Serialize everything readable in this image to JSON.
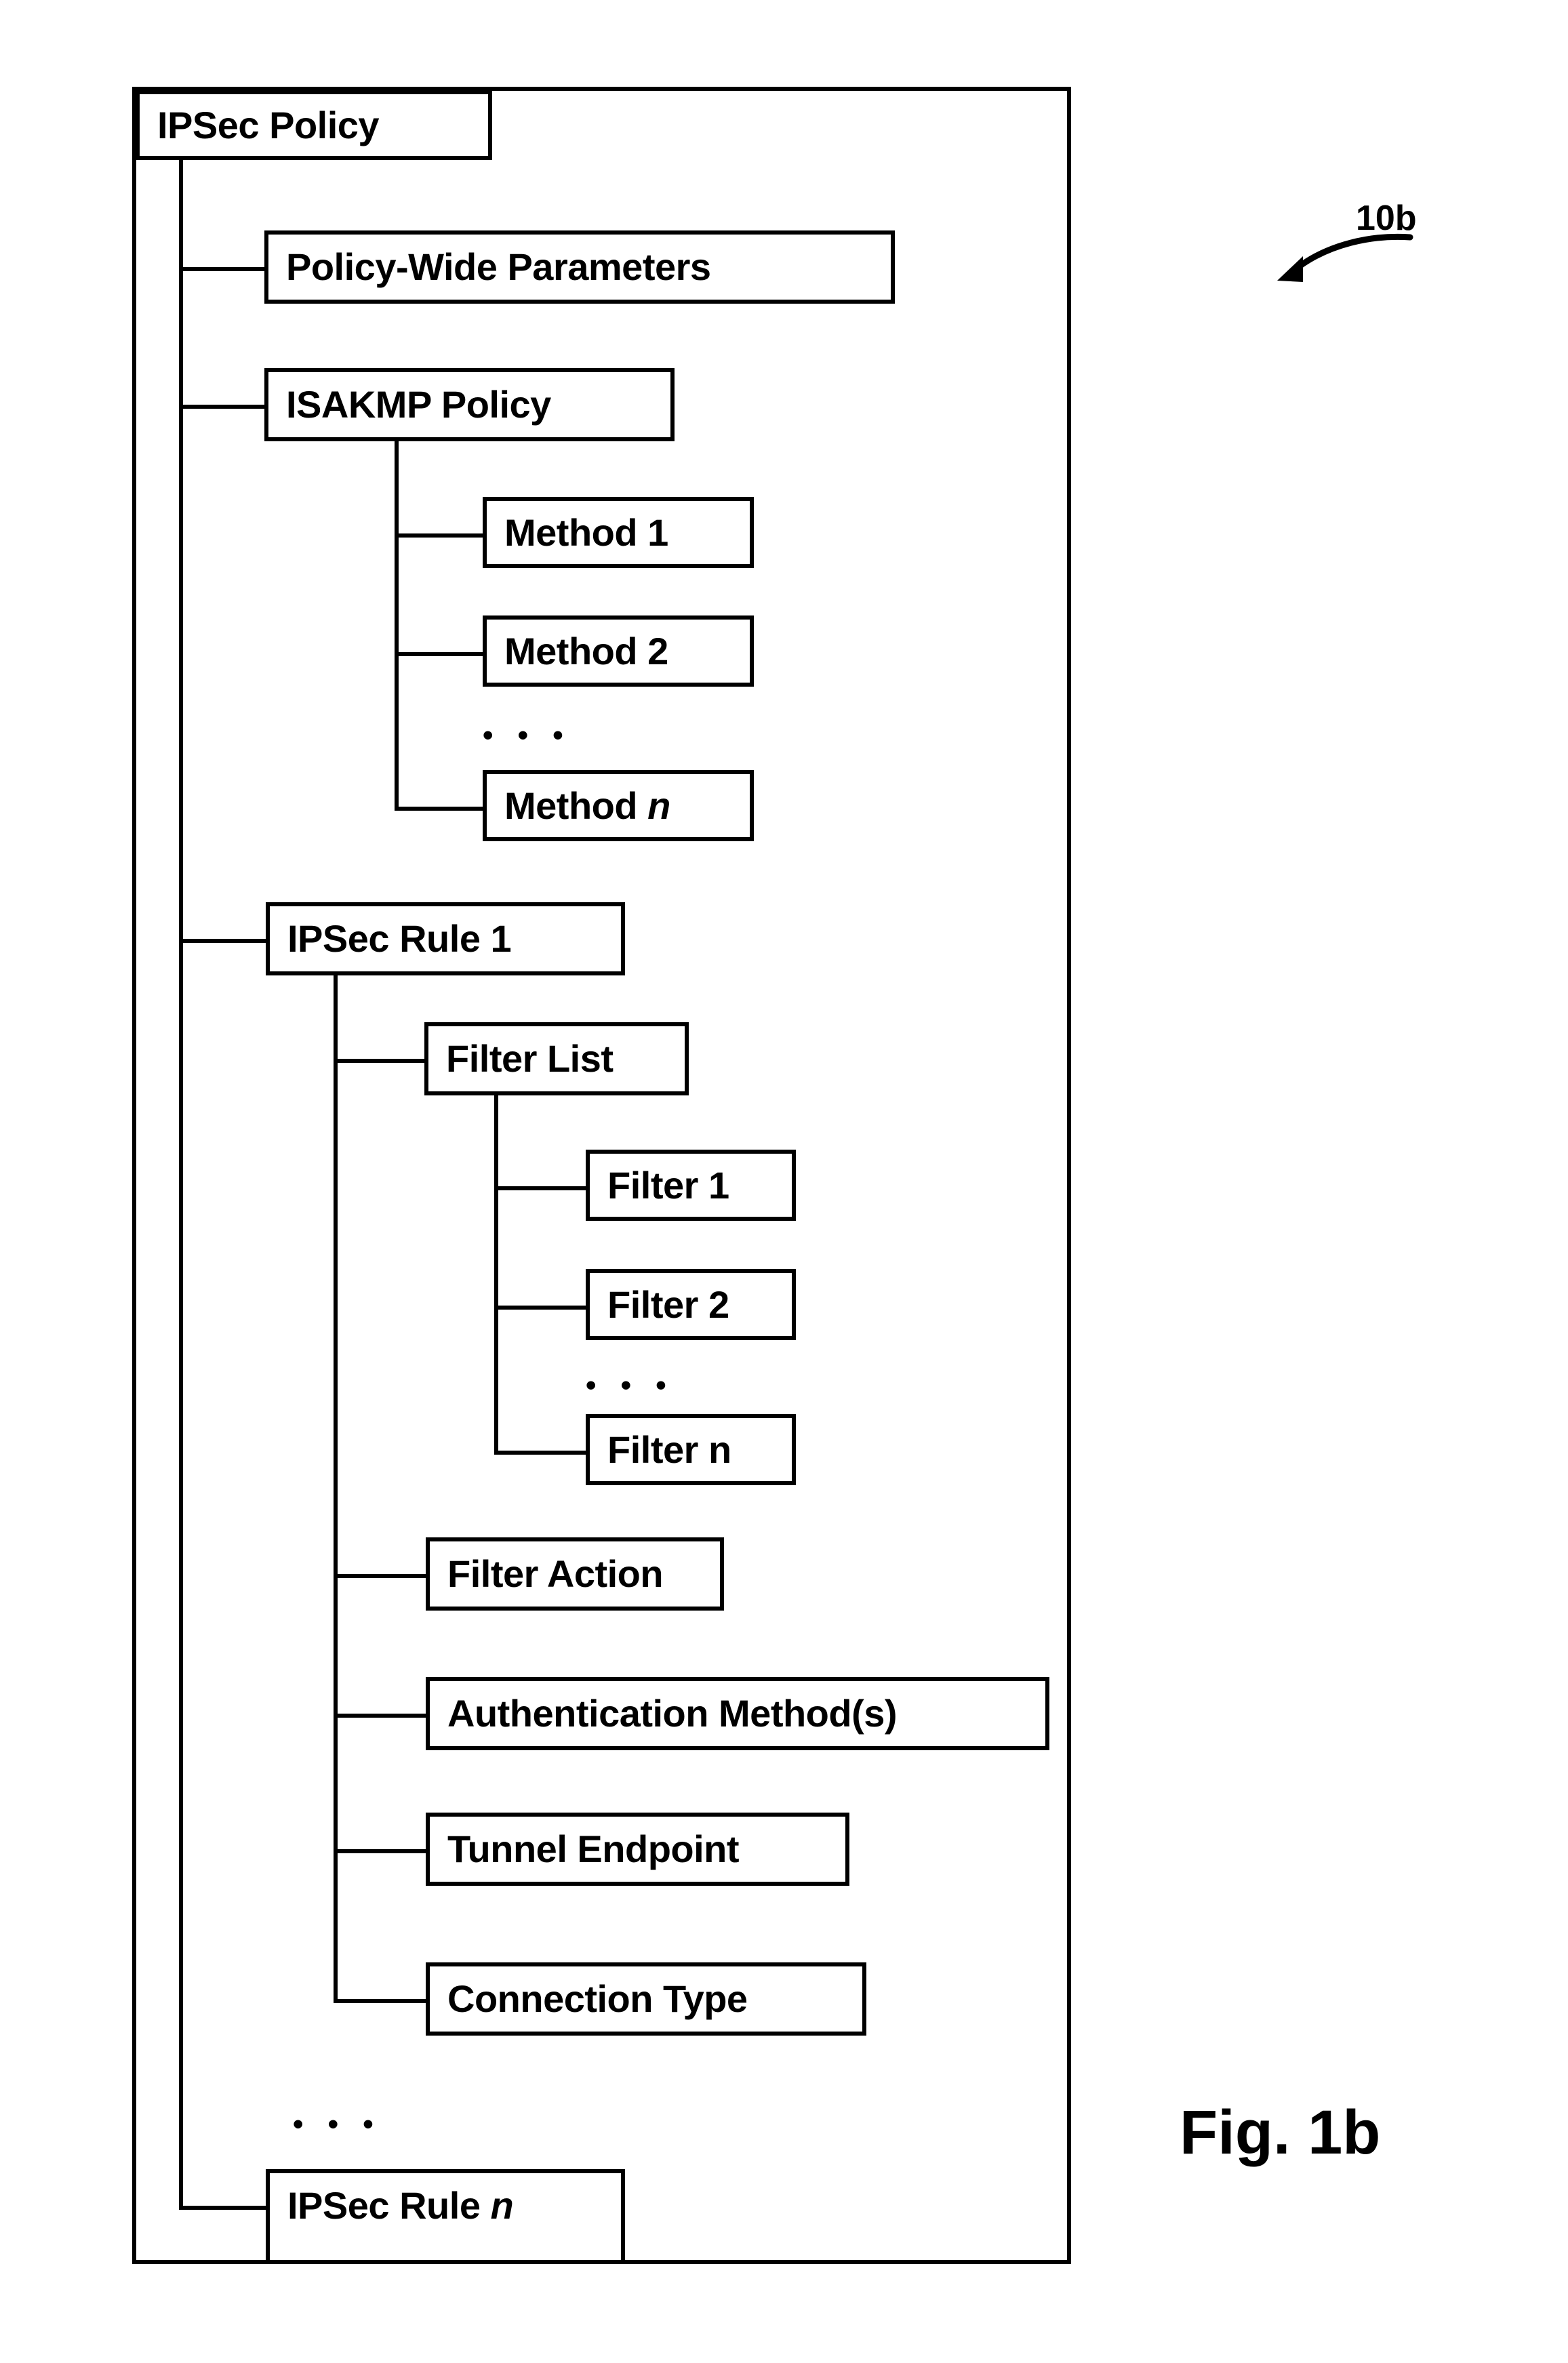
{
  "figure": {
    "caption": "Fig. 1b",
    "reference_numeral": "10b"
  },
  "diagram": {
    "type": "tree-hierarchy",
    "root": {
      "label": "IPSec Policy"
    },
    "level1": [
      {
        "label": "Policy-Wide Parameters"
      },
      {
        "label": "ISAKMP Policy"
      },
      {
        "label": "IPSec Rule 1"
      },
      {
        "label_prefix": "IPSec Rule ",
        "label_italic": "n"
      }
    ],
    "isakmp_children": [
      {
        "label": "Method 1"
      },
      {
        "label": "Method 2"
      },
      {
        "label_prefix": "Method ",
        "label_italic": "n"
      }
    ],
    "isakmp_ellipsis": "• • •",
    "rule1_children": [
      {
        "label": "Filter List"
      },
      {
        "label": "Filter Action"
      },
      {
        "label": "Authentication Method(s)"
      },
      {
        "label": "Tunnel Endpoint"
      },
      {
        "label": "Connection Type"
      }
    ],
    "filter_list_children": [
      {
        "label": "Filter 1"
      },
      {
        "label": "Filter 2"
      },
      {
        "label": "Filter n"
      }
    ],
    "filter_ellipsis": "• • •",
    "rules_ellipsis": "• • •"
  },
  "colors": {
    "ink": "#000000",
    "paper": "#ffffff"
  }
}
